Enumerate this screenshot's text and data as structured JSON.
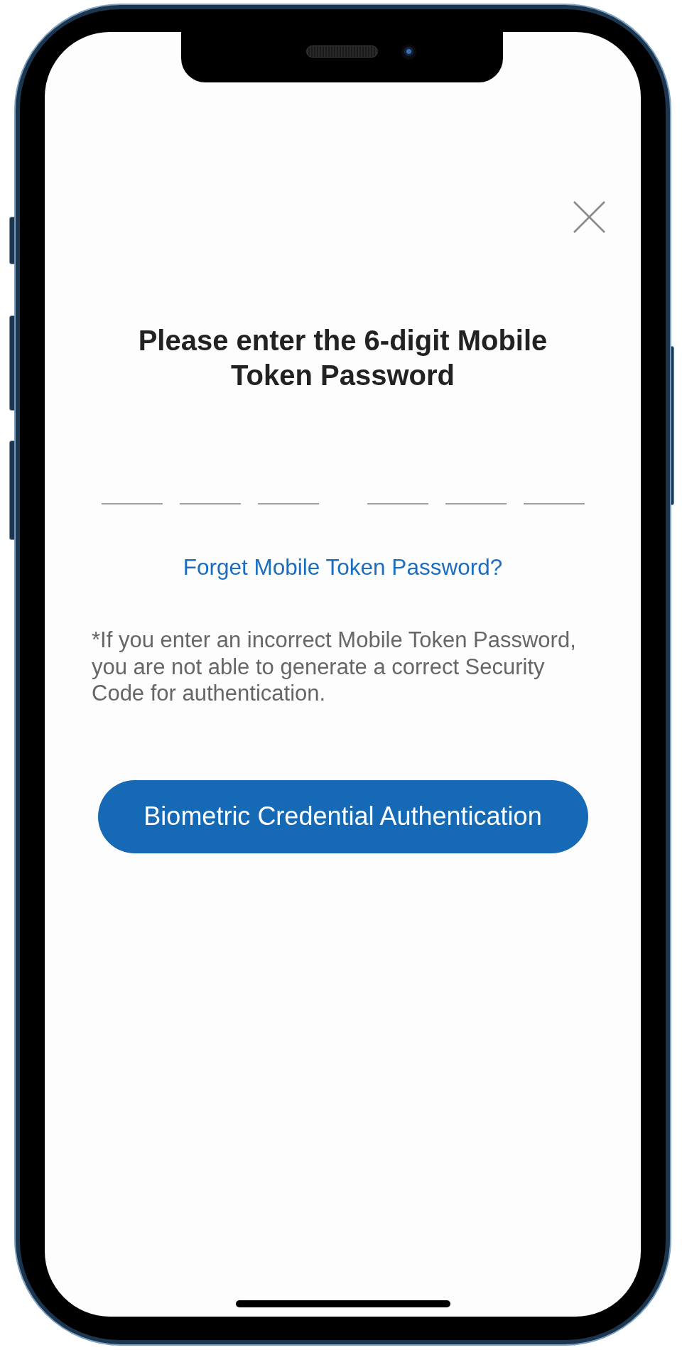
{
  "dialog": {
    "title": "Please enter the 6-digit Mobile Token Password",
    "code_slots": [
      {
        "filled": false
      },
      {
        "filled": false
      },
      {
        "filled": false
      },
      {
        "filled": false
      },
      {
        "filled": false
      },
      {
        "filled": false
      }
    ],
    "forgot_link": "Forget Mobile Token Password?",
    "note": "*If you enter an incorrect Mobile Token Password, you are not able to generate a correct Security Code for authentication.",
    "primary_button": "Biometric Credential Authentication"
  }
}
